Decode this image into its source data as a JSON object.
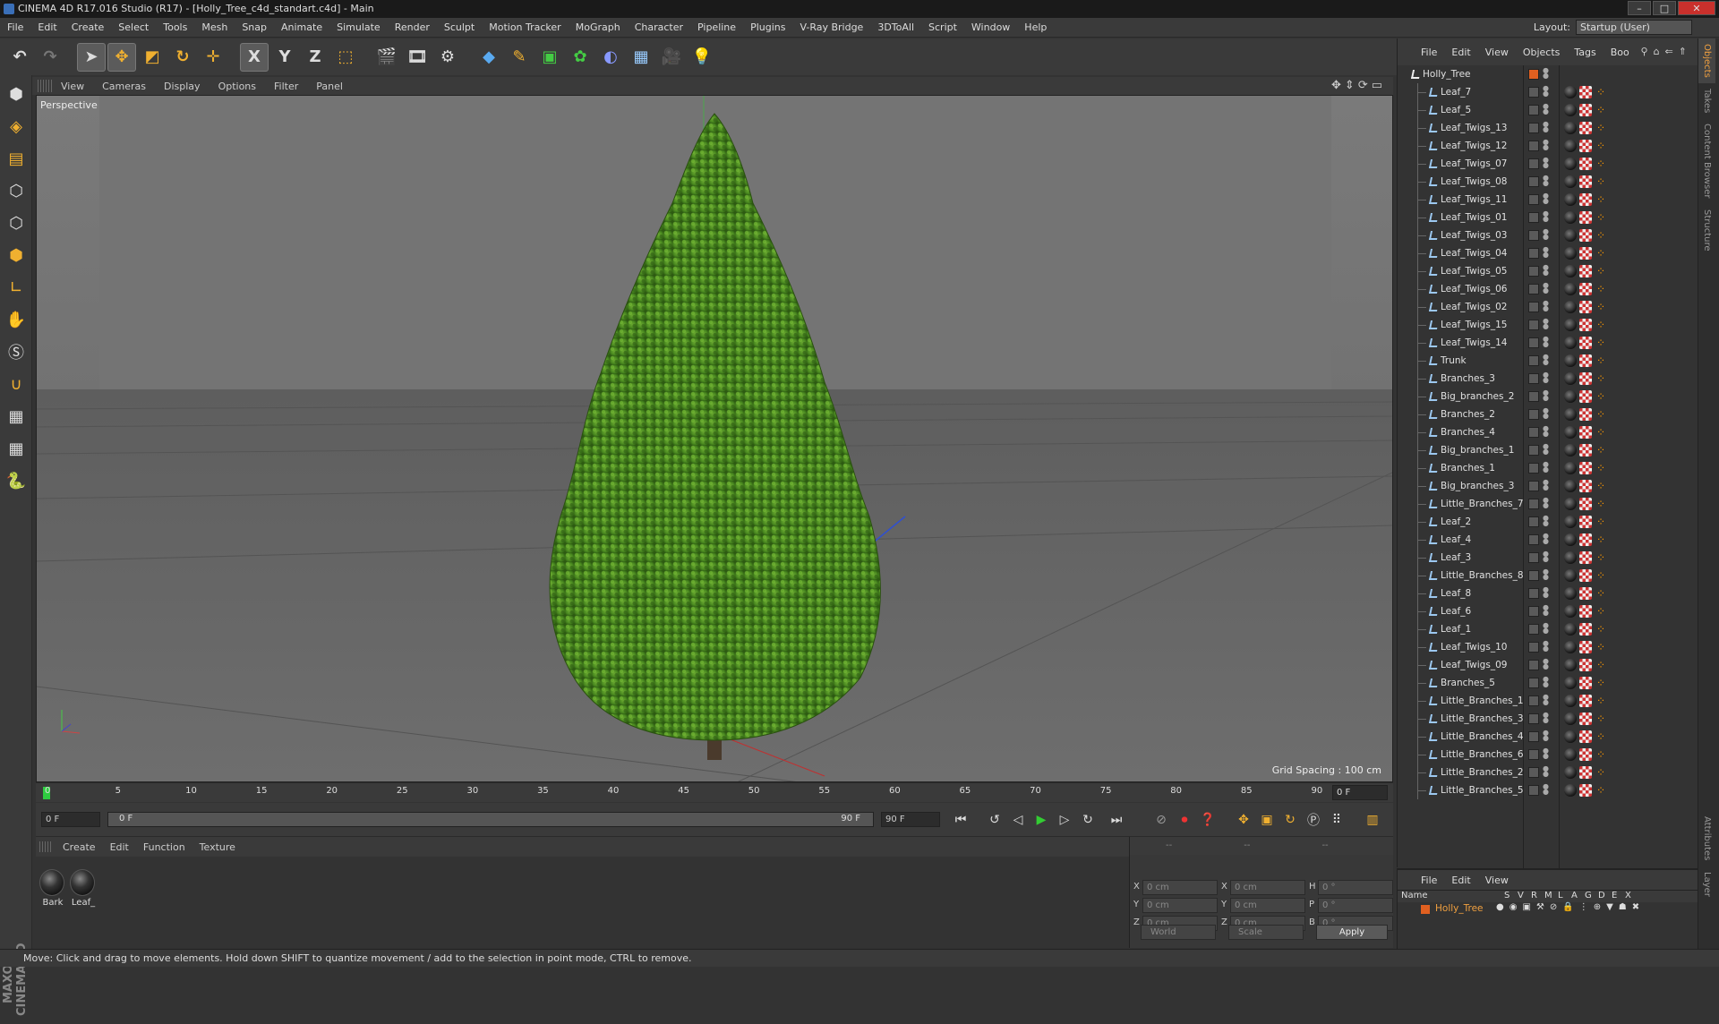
{
  "titlebar": {
    "title": "CINEMA 4D R17.016 Studio (R17) - [Holly_Tree_c4d_standart.c4d] - Main"
  },
  "menubar": {
    "items": [
      "File",
      "Edit",
      "Create",
      "Select",
      "Tools",
      "Mesh",
      "Snap",
      "Animate",
      "Simulate",
      "Render",
      "Sculpt",
      "Motion Tracker",
      "MoGraph",
      "Character",
      "Pipeline",
      "Plugins",
      "V-Ray Bridge",
      "3DToAll",
      "Script",
      "Window",
      "Help"
    ],
    "layout_label": "Layout:",
    "layout_value": "Startup (User)"
  },
  "toolbar": {
    "icons": [
      "undo-icon",
      "redo-icon",
      "select-icon",
      "move-icon",
      "scale-icon",
      "rotate-icon",
      "live-select-icon",
      "x-axis-icon",
      "y-axis-icon",
      "z-axis-icon",
      "coordinate-system-icon",
      "render-view-icon",
      "render-picture-viewer-icon",
      "render-settings-icon",
      "cube-icon",
      "pen-icon",
      "subdivision-icon",
      "cloner-icon",
      "deformer-icon",
      "floor-icon",
      "camera-icon",
      "light-icon"
    ],
    "axis_labels": [
      "X",
      "Y",
      "Z"
    ]
  },
  "lefttools": {
    "icons": [
      "model-mode-icon",
      "texture-mode-icon",
      "workplane-icon",
      "points-mode-icon",
      "edges-mode-icon",
      "polygons-mode-icon",
      "axis-mode-icon",
      "tweak-icon",
      "snap-icon",
      "magnet-icon",
      "grid-lock-icon",
      "grid-snap-icon",
      "python-icon"
    ]
  },
  "maxon_logo": "MAXON CINEMA 4D",
  "viewport": {
    "menu": [
      "View",
      "Cameras",
      "Display",
      "Options",
      "Filter",
      "Panel"
    ],
    "label": "Perspective",
    "grid_spacing": "Grid Spacing : 100 cm"
  },
  "timeline": {
    "ticks": [
      "0",
      "5",
      "10",
      "15",
      "20",
      "25",
      "30",
      "35",
      "40",
      "45",
      "50",
      "55",
      "60",
      "65",
      "70",
      "75",
      "80",
      "85",
      "90"
    ],
    "current_frame": "0 F"
  },
  "transport": {
    "start_field": "0 F",
    "range_start": "0 F",
    "range_end": "90 F",
    "end_field": "90 F"
  },
  "materials": {
    "menu": [
      "Create",
      "Edit",
      "Function",
      "Texture"
    ],
    "items": [
      "Bark",
      "Leaf_"
    ]
  },
  "coords": {
    "header": [
      "--",
      "--",
      "--"
    ],
    "rows": [
      {
        "a1": "X",
        "v1": "0 cm",
        "a2": "X",
        "v2": "0 cm",
        "a3": "H",
        "v3": "0 °"
      },
      {
        "a1": "Y",
        "v1": "0 cm",
        "a2": "Y",
        "v2": "0 cm",
        "a3": "P",
        "v3": "0 °"
      },
      {
        "a1": "Z",
        "v1": "0 cm",
        "a2": "Z",
        "v2": "0 cm",
        "a3": "B",
        "v3": "0 °"
      }
    ],
    "world": "World",
    "scale": "Scale",
    "apply": "Apply"
  },
  "objmgr": {
    "menu": [
      "File",
      "Edit",
      "View",
      "Objects",
      "Tags",
      "Boo"
    ],
    "root": "Holly_Tree",
    "objects": [
      "Leaf_7",
      "Leaf_5",
      "Leaf_Twigs_13",
      "Leaf_Twigs_12",
      "Leaf_Twigs_07",
      "Leaf_Twigs_08",
      "Leaf_Twigs_11",
      "Leaf_Twigs_01",
      "Leaf_Twigs_03",
      "Leaf_Twigs_04",
      "Leaf_Twigs_05",
      "Leaf_Twigs_06",
      "Leaf_Twigs_02",
      "Leaf_Twigs_15",
      "Leaf_Twigs_14",
      "Trunk",
      "Branches_3",
      "Big_branches_2",
      "Branches_2",
      "Branches_4",
      "Big_branches_1",
      "Branches_1",
      "Big_branches_3",
      "Little_Branches_7",
      "Leaf_2",
      "Leaf_4",
      "Leaf_3",
      "Little_Branches_8",
      "Leaf_8",
      "Leaf_6",
      "Leaf_1",
      "Leaf_Twigs_10",
      "Leaf_Twigs_09",
      "Branches_5",
      "Little_Branches_1",
      "Little_Branches_3",
      "Little_Branches_4",
      "Little_Branches_6",
      "Little_Branches_2",
      "Little_Branches_5"
    ]
  },
  "layermgr": {
    "menu": [
      "File",
      "Edit",
      "View"
    ],
    "headers": [
      "Name",
      "S",
      "V",
      "R",
      "M",
      "L",
      "A",
      "G",
      "D",
      "E",
      "X"
    ],
    "layer": "Holly_Tree"
  },
  "sidetabs": [
    "Objects",
    "Takes",
    "Content Browser",
    "Structure",
    "Attributes",
    "Layer"
  ],
  "statusbar": {
    "text": "Move: Click and drag to move elements. Hold down SHIFT to quantize movement / add to the selection in point mode, CTRL to remove."
  },
  "colors": {
    "accent": "#f0a040",
    "timeline_marker": "#2ecc40",
    "layer_color": "#e06020"
  }
}
